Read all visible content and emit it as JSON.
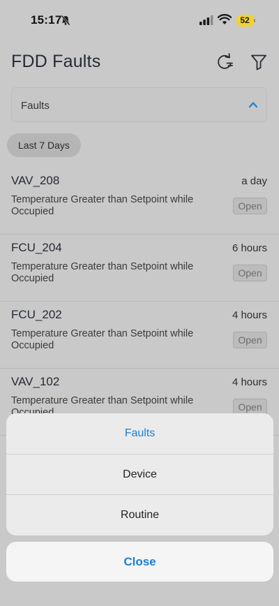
{
  "status_bar": {
    "time": "15:17",
    "battery": "52"
  },
  "header": {
    "title": "FDD Faults",
    "icons": [
      "refresh-icon",
      "filter-icon"
    ]
  },
  "dropdown": {
    "selected": "Faults"
  },
  "filter_chip": {
    "label": "Last 7 Days"
  },
  "faults": [
    {
      "device": "VAV_208",
      "time": "a day",
      "description": "Temperature Greater than Setpoint while Occupied",
      "status": "Open"
    },
    {
      "device": "FCU_204",
      "time": "6 hours",
      "description": "Temperature Greater than Setpoint while Occupied",
      "status": "Open"
    },
    {
      "device": "FCU_202",
      "time": "4 hours",
      "description": "Temperature Greater than Setpoint while Occupied",
      "status": "Open"
    },
    {
      "device": "VAV_102",
      "time": "4 hours",
      "description": "Temperature Greater than Setpoint while Occupied",
      "status": "Open"
    }
  ],
  "action_sheet": {
    "options": [
      "Faults",
      "Device",
      "Routine"
    ],
    "selected_index": 0,
    "close_label": "Close"
  },
  "colors": {
    "accent": "#1a7fd4",
    "battery": "#f2d22e",
    "overlay_bg": "#c9c9c9"
  }
}
